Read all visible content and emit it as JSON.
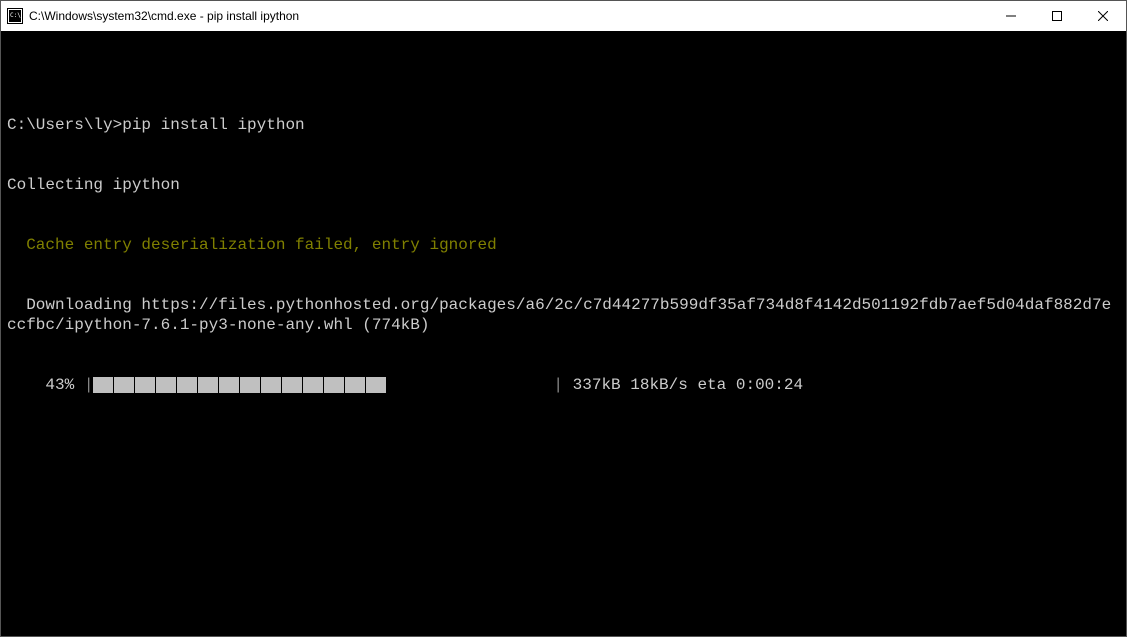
{
  "window": {
    "title": "C:\\Windows\\system32\\cmd.exe - pip  install ipython"
  },
  "terminal": {
    "blank": "",
    "promptLine": "C:\\Users\\ly>pip install ipython",
    "collecting": "Collecting ipython",
    "cacheWarn": "  Cache entry deserialization failed, entry ignored",
    "downloading": "  Downloading https://files.pythonhosted.org/packages/a6/2c/c7d44277b599df35af734d8f4142d501192fdb7aef5d04daf882d7eccfbc/ipython-7.6.1-py3-none-any.whl (774kB)",
    "progress": {
      "percentText": "    43% ",
      "openBar": "|",
      "filledBlocks": 14,
      "closeBar": "|",
      "stats": " 337kB 18kB/s eta 0:00:24"
    }
  }
}
